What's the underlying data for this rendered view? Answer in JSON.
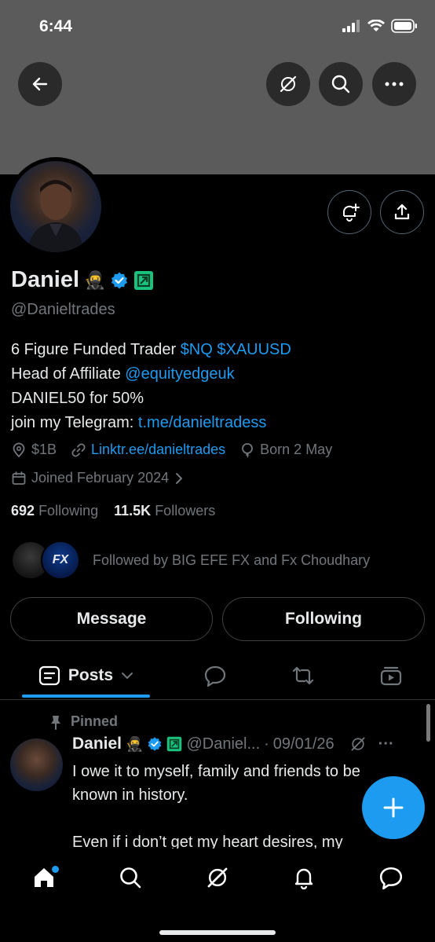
{
  "status_bar": {
    "time": "6:44"
  },
  "profile": {
    "name": "Daniel",
    "name_emoji": "🥷",
    "handle": "@Danieltrades",
    "bio": {
      "line1_text": "6 Figure Funded Trader ",
      "line1_cashtags": "$NQ $XAUUSD",
      "line2_text": "Head of Affiliate ",
      "line2_mention": "@equityedgeuk",
      "line3": "DANIEL50 for 50%",
      "line4_text": "join my Telegram: ",
      "line4_link": "t.me/danieltradess"
    },
    "meta": {
      "location": "$1B",
      "website": "Linktr.ee/danieltrades",
      "born": "Born 2 May",
      "joined": "Joined February 2024"
    },
    "following_count": "692",
    "following_label": "Following",
    "followers_count": "11.5K",
    "followers_label": "Followers",
    "followed_by": "Followed by BIG EFE FX and Fx Choudhary",
    "mini_avatar_text": "FX"
  },
  "actions": {
    "message": "Message",
    "following": "Following"
  },
  "tabs": {
    "posts": "Posts"
  },
  "post": {
    "pinned_label": "Pinned",
    "name": "Daniel",
    "name_emoji": "🥷",
    "handle": "@Daniel...",
    "separator": "·",
    "date": "09/01/26",
    "more": "···",
    "line1": "I owe it to myself, family and friends to be",
    "line2": "known in history.",
    "line3": "Even if i don’t get my heart desires, my"
  },
  "colors": {
    "accent": "#1d9bf0",
    "banner": "#5b5b5b",
    "muted_text": "#71767b",
    "badge_green": "#19c37d"
  },
  "icons": {
    "back": "arrow-left-icon",
    "grok": "grok-icon",
    "search": "search-icon",
    "more": "more-icon",
    "notify": "bell-plus-icon",
    "share": "share-icon",
    "location": "location-pin-icon",
    "link": "link-icon",
    "balloon": "balloon-icon",
    "calendar": "calendar-icon"
  }
}
